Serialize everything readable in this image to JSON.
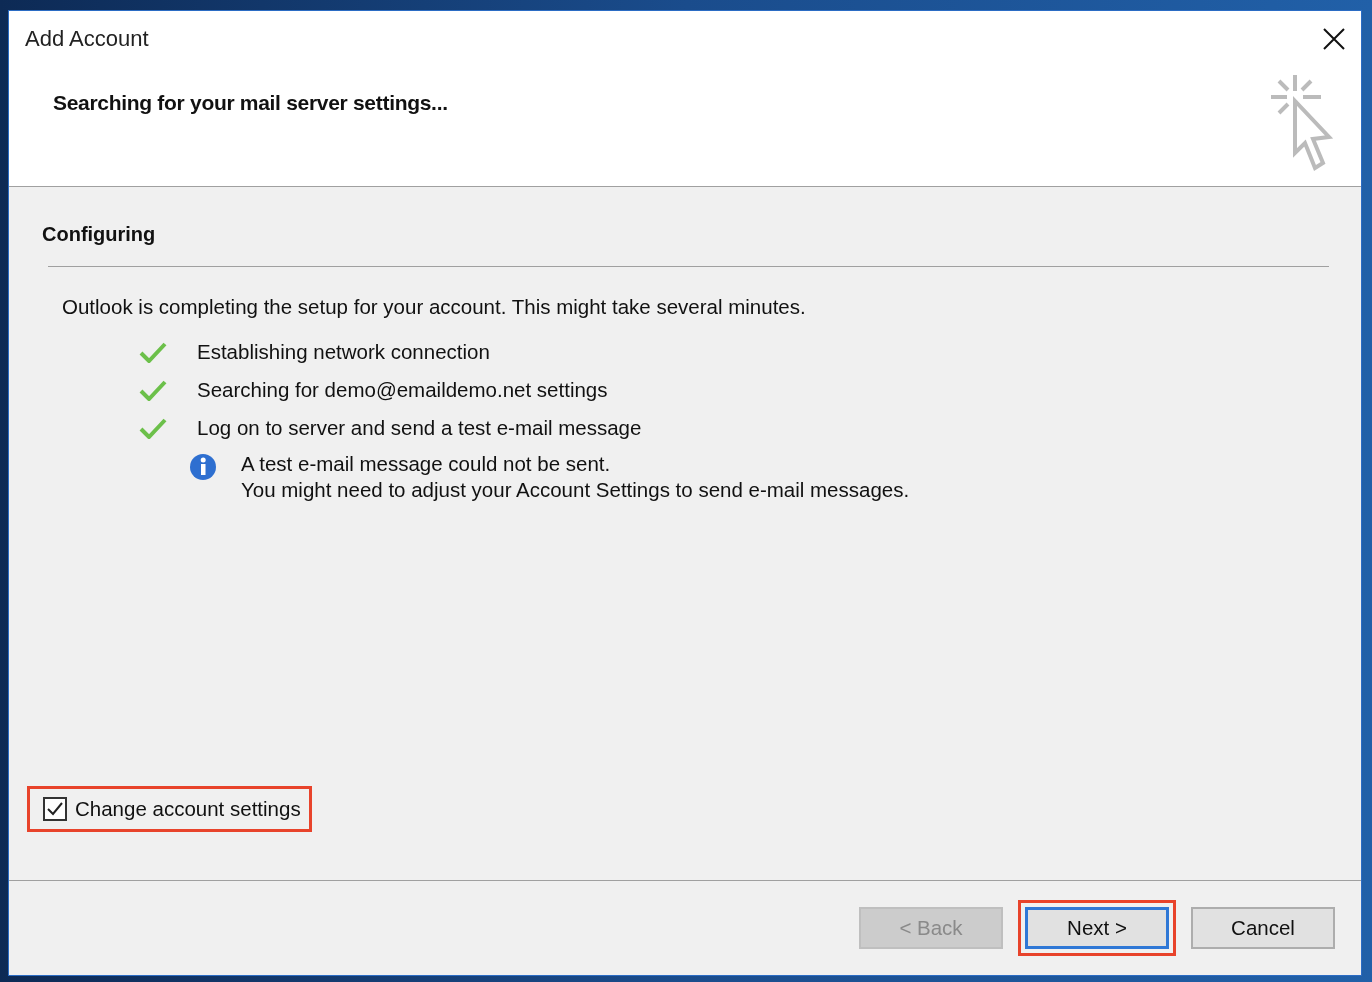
{
  "window": {
    "title": "Add Account"
  },
  "header": {
    "heading": "Searching for your mail server settings..."
  },
  "section": {
    "title": "Configuring",
    "intro": "Outlook is completing the setup for your account. This might take several minutes.",
    "steps": [
      {
        "text": "Establishing network connection",
        "done": true
      },
      {
        "text": "Searching for demo@emaildemo.net settings",
        "done": true
      },
      {
        "text": "Log on to server and send a test e-mail message",
        "done": true
      }
    ],
    "notice": {
      "lines": [
        "A test e-mail message could not be sent.",
        "You might need to adjust your Account Settings to send e-mail messages."
      ]
    }
  },
  "checkbox": {
    "label": "Change account settings",
    "checked": true,
    "highlighted": true
  },
  "buttons": [
    {
      "label": "< Back",
      "disabled": true,
      "default": false,
      "highlighted": false
    },
    {
      "label": "Next >",
      "disabled": false,
      "default": true,
      "highlighted": true
    },
    {
      "label": "Cancel",
      "disabled": false,
      "default": false,
      "highlighted": false
    }
  ]
}
